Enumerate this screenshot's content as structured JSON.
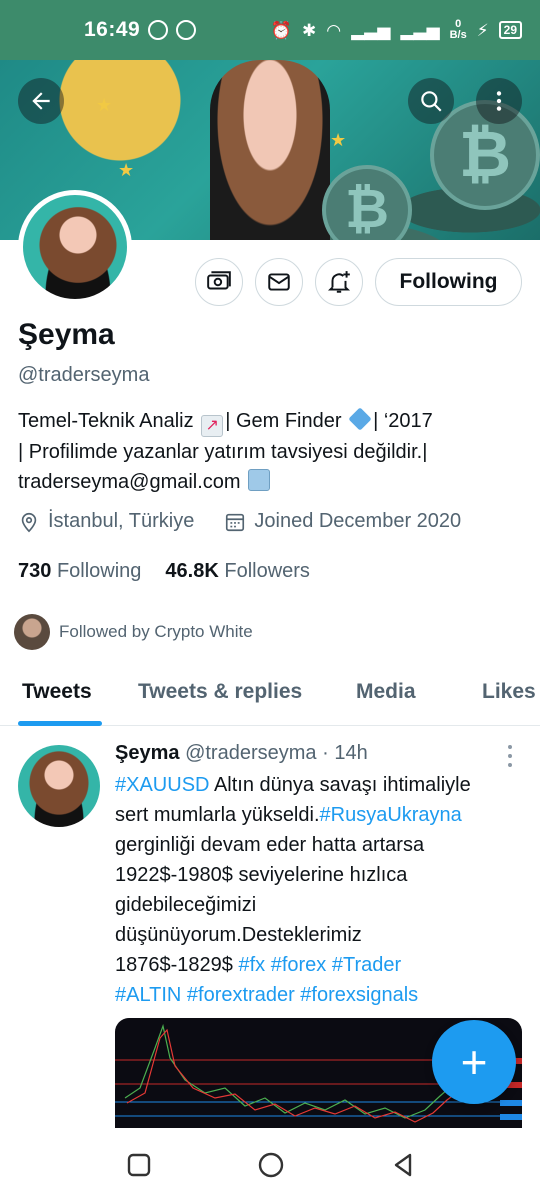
{
  "status_bar": {
    "time": "16:49",
    "net_speed_value": "0",
    "net_speed_unit": "B/s",
    "battery": "29"
  },
  "header": {
    "back_icon": "arrow-left-icon",
    "search_icon": "search-icon",
    "more_icon": "more-vertical-icon"
  },
  "profile": {
    "name": "Şeyma",
    "handle": "@traderseyma",
    "bio_line1_a": "Temel-Teknik Analiz",
    "bio_line1_b": "| Gem Finder",
    "bio_line1_c": "| ‘2017",
    "bio_line2": "| Profilimde yazanlar yatırım tavsiyesi değildir.|",
    "bio_line3": "traderseyma@gmail.com",
    "location": "İstanbul, Türkiye",
    "joined": "Joined December 2020",
    "following_count": "730",
    "following_label": "Following",
    "followers_count": "46.8K",
    "followers_label": "Followers",
    "followed_by": "Followed by Crypto White"
  },
  "actions": {
    "following_button": "Following"
  },
  "tabs": [
    {
      "label": "Tweets",
      "active": true
    },
    {
      "label": "Tweets & replies",
      "active": false
    },
    {
      "label": "Media",
      "active": false
    },
    {
      "label": "Likes",
      "active": false
    }
  ],
  "tweet": {
    "author": "Şeyma",
    "handle": "@traderseyma",
    "separator": "·",
    "time": "14h",
    "line1_tag": "#XAUUSD",
    "line1_text": " Altın dünya savaşı ihtimaliyle",
    "line2_text": "sert mumlarla yükseldi.",
    "line2_tag": "#RusyaUkrayna",
    "line3": "gerginliği devam eder hatta artarsa",
    "line4": "1922$-1980$ seviyelerine hızlıca",
    "line5": "gidebileceğimizi",
    "line6": "düşünüyorum.Desteklerimiz",
    "line7_text": "1876$-1829$ ",
    "line7_tag1": "#fx",
    "line7_tag2": "#forex",
    "line7_tag3": "#Trader",
    "line8_tag1": "#ALTIN",
    "line8_tag2": "#forextrader",
    "line8_tag3": "#forexsignals"
  },
  "fab": {
    "label": "+"
  },
  "colors": {
    "status_bar": "#3d8b6b",
    "accent": "#1d9bf0",
    "text_primary": "#0f1419",
    "text_secondary": "#536471"
  }
}
